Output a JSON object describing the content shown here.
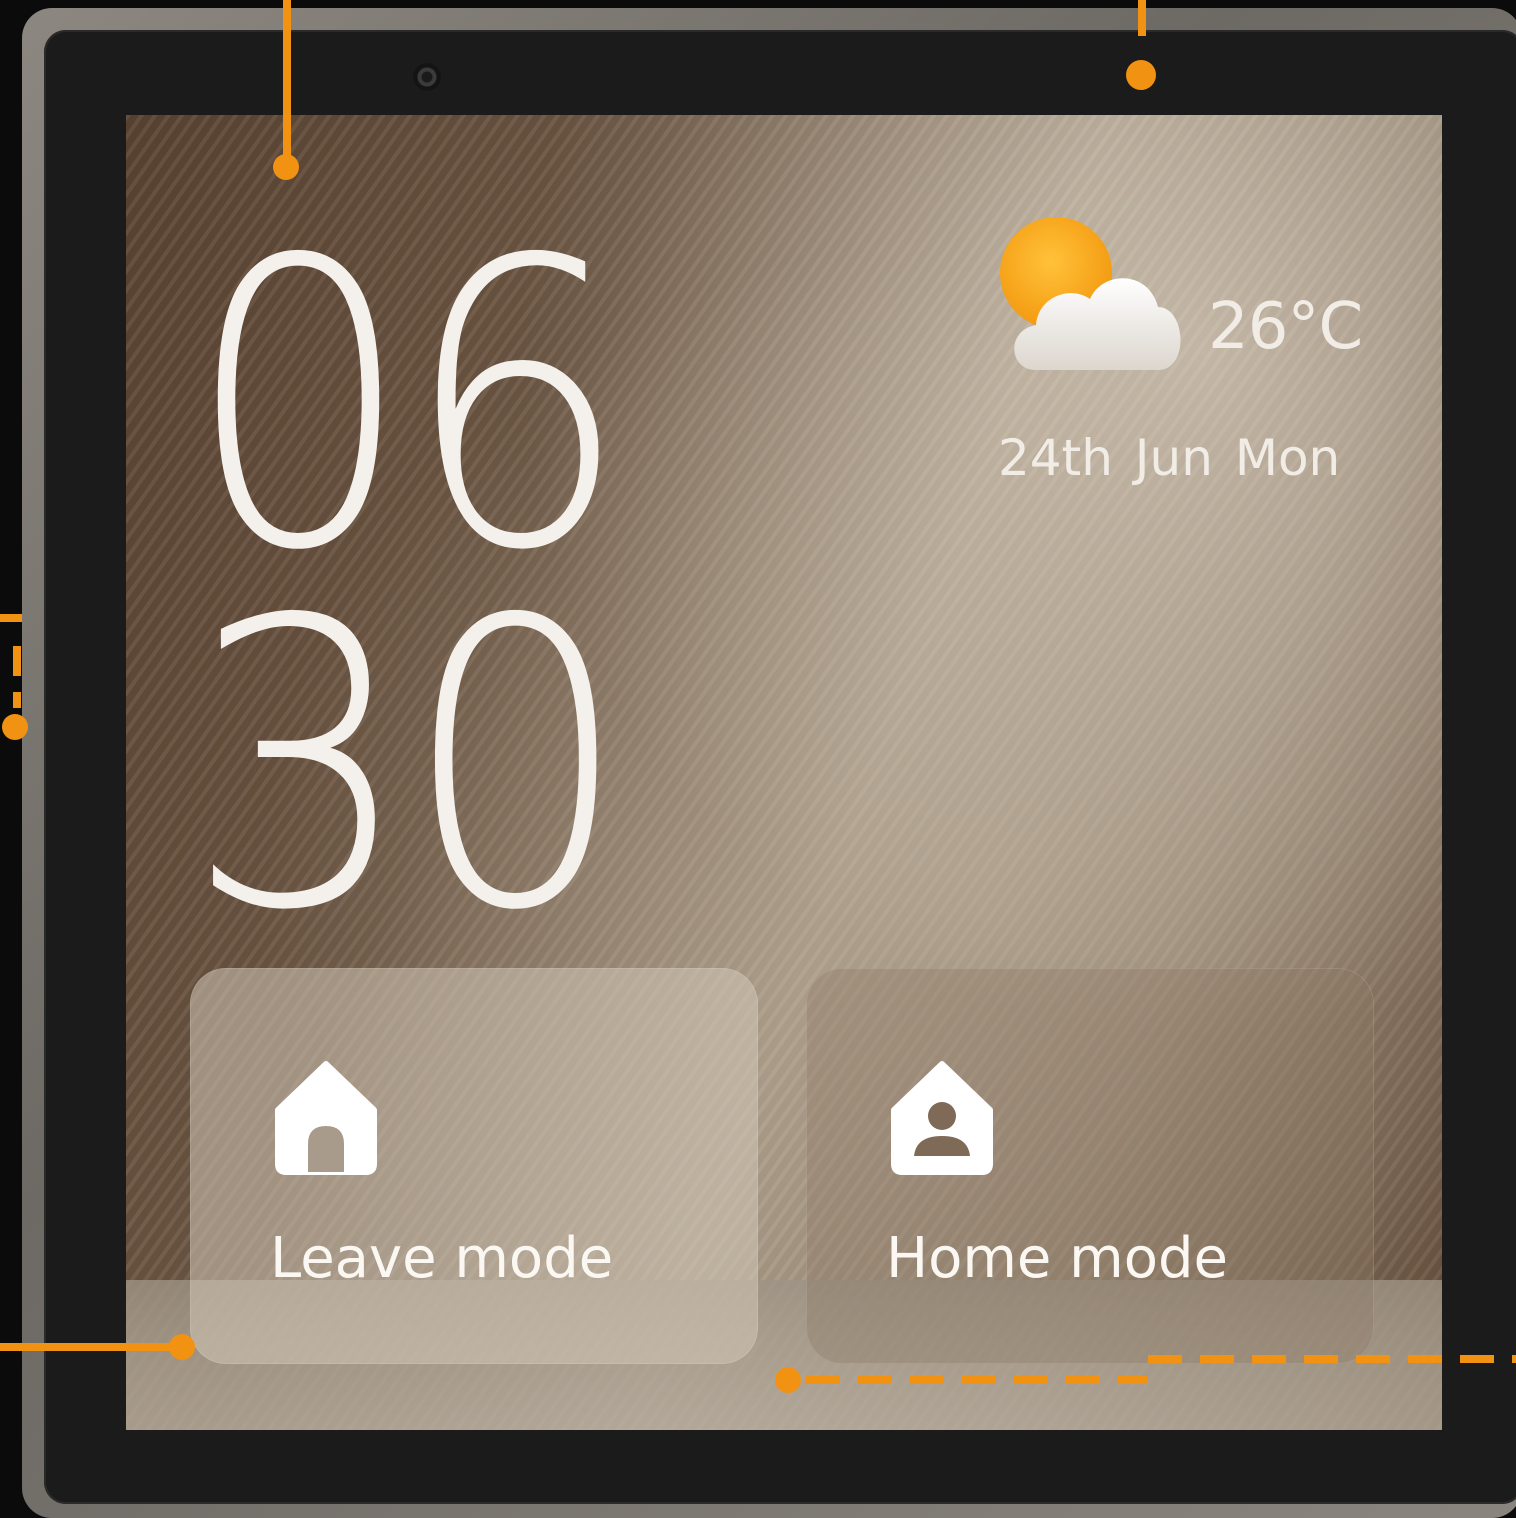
{
  "clock": {
    "hours": "06",
    "minutes": "30"
  },
  "weather": {
    "icon": "partly-cloudy-icon",
    "temperature": "26°C"
  },
  "date": "24th Jun  Mon",
  "modes": [
    {
      "label": "Leave mode",
      "icon": "house-icon"
    },
    {
      "label": "Home mode",
      "icon": "house-person-icon"
    }
  ],
  "colors": {
    "accent": "#f29212",
    "text": "#f4f1ec",
    "bezel": "#1b1b1b"
  }
}
